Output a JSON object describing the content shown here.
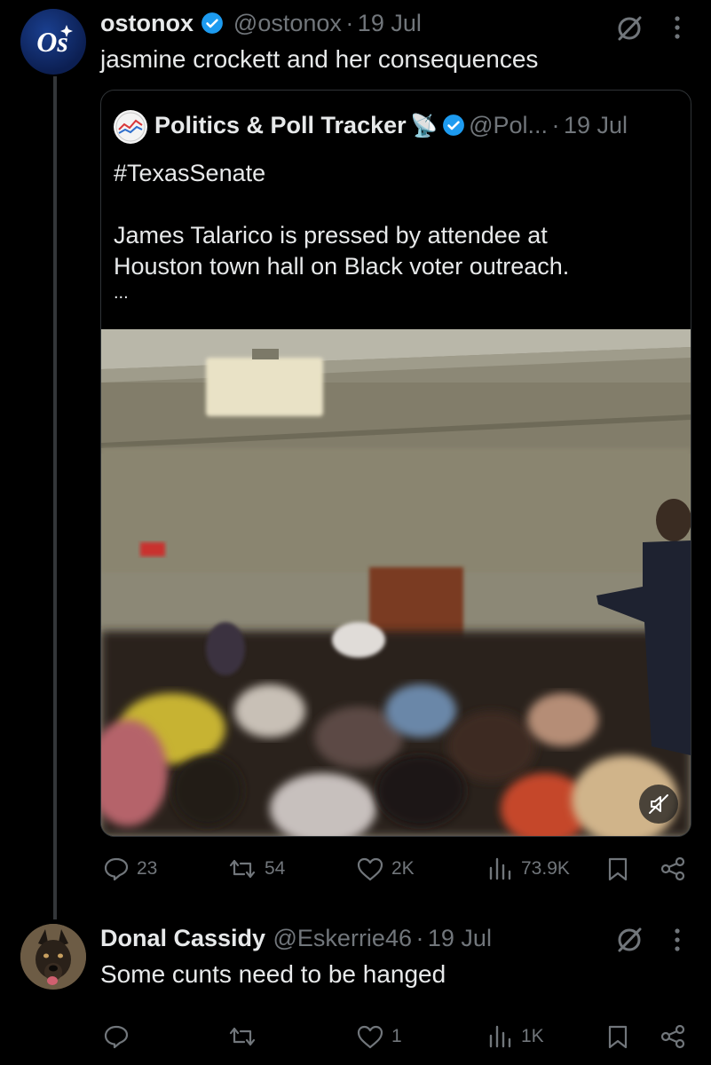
{
  "post1": {
    "avatar_text": "Os",
    "name": "ostonox",
    "handle": "@ostonox",
    "separator": "·",
    "date": "19 Jul",
    "text": "jasmine crockett and her consequences",
    "quote": {
      "name": "Politics & Poll Tracker",
      "emoji": "📡",
      "handle": "@Pol...",
      "separator": "·",
      "date": "19 Jul",
      "hashtag": "#TexasSenate",
      "line1": "James Talarico is pressed by attendee at",
      "line2": "Houston town hall on Black voter outreach.",
      "more": "..."
    },
    "actions": {
      "replies": "23",
      "reposts": "54",
      "likes": "2K",
      "views": "73.9K"
    }
  },
  "post2": {
    "name": "Donal Cassidy",
    "handle": "@Eskerrie46",
    "separator": "·",
    "date": "19 Jul",
    "text": "Some cunts need to be hanged",
    "actions": {
      "likes": "1",
      "views": "1K"
    }
  },
  "colors": {
    "background": "#000000",
    "text": "#e7e9ea",
    "muted": "#71767b",
    "verified": "#1d9bf0"
  }
}
